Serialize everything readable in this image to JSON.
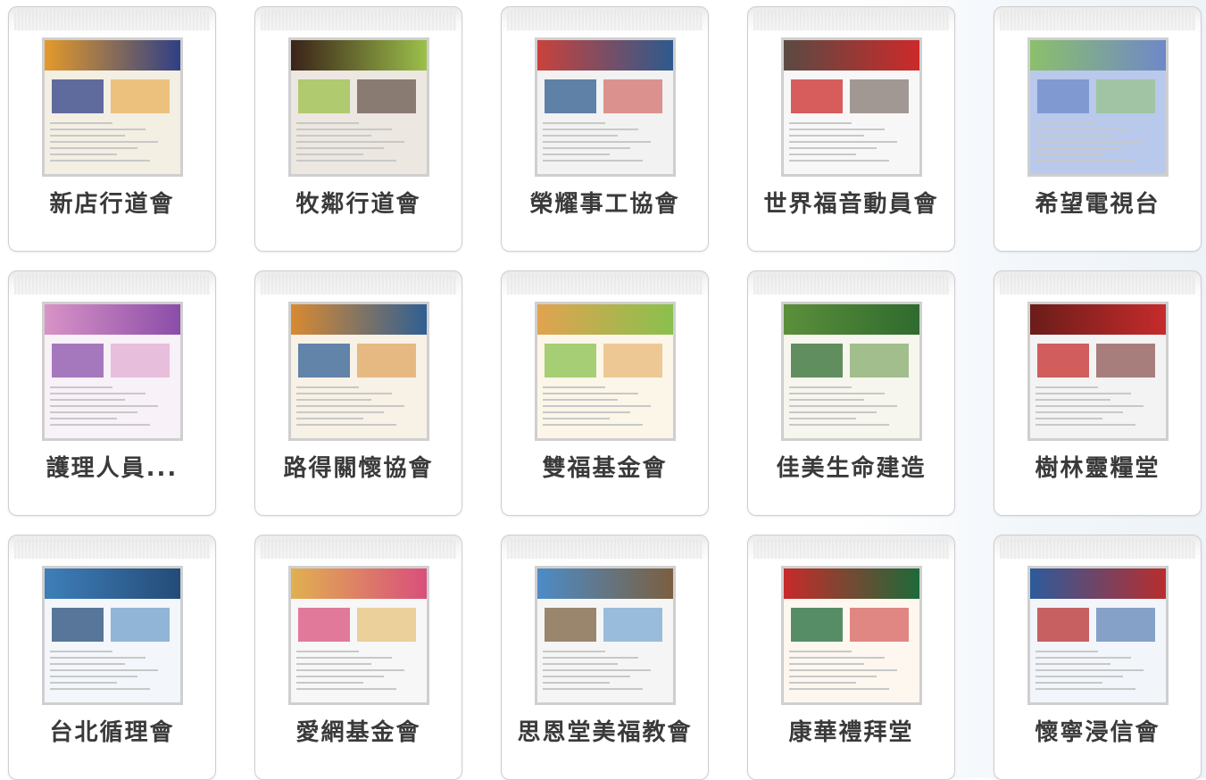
{
  "cards": [
    {
      "label": "新店行道會",
      "head": "#e39a2a",
      "accent": "#2f3f86",
      "body": "#f4efe3"
    },
    {
      "label": "牧鄰行道會",
      "head": "#3a2218",
      "accent": "#9bc04a",
      "body": "#ece7e0"
    },
    {
      "label": "榮耀事工協會",
      "head": "#c9423b",
      "accent": "#2d5a8e",
      "body": "#f2f2f2"
    },
    {
      "label": "世界福音動員會",
      "head": "#5b4a43",
      "accent": "#cc2a2a",
      "body": "#f7f7f7"
    },
    {
      "label": "希望電視台",
      "head": "#8cc06a",
      "accent": "#6e88c8",
      "body": "#b9c9ec"
    },
    {
      "label": "護理人員...",
      "head": "#d993c7",
      "accent": "#8a4da8",
      "body": "#f8f1f7"
    },
    {
      "label": "路得關懷協會",
      "head": "#d98a32",
      "accent": "#2f5f93",
      "body": "#f7f1e6"
    },
    {
      "label": "雙福基金會",
      "head": "#e1a350",
      "accent": "#8ac04d",
      "body": "#fbf6e8"
    },
    {
      "label": "佳美生命建造",
      "head": "#5b8f3a",
      "accent": "#2f6b2e",
      "body": "#f6f6ef"
    },
    {
      "label": "樹林靈糧堂",
      "head": "#6a1d1a",
      "accent": "#c62b2b",
      "body": "#f3f3f3"
    },
    {
      "label": "台北循理會",
      "head": "#3e7fb9",
      "accent": "#244b78",
      "body": "#f3f6fa"
    },
    {
      "label": "愛網基金會",
      "head": "#e1b050",
      "accent": "#d94f7c",
      "body": "#f7f7f7"
    },
    {
      "label": "思恩堂美福教會",
      "head": "#4c8cc7",
      "accent": "#7b5f3f",
      "body": "#f5f5f5"
    },
    {
      "label": "康華禮拜堂",
      "head": "#c82a2a",
      "accent": "#1d6a3a",
      "body": "#fdf7ef"
    },
    {
      "label": "懷寧浸信會",
      "head": "#2c5b9c",
      "accent": "#b82d2d",
      "body": "#f2f5fa"
    }
  ]
}
